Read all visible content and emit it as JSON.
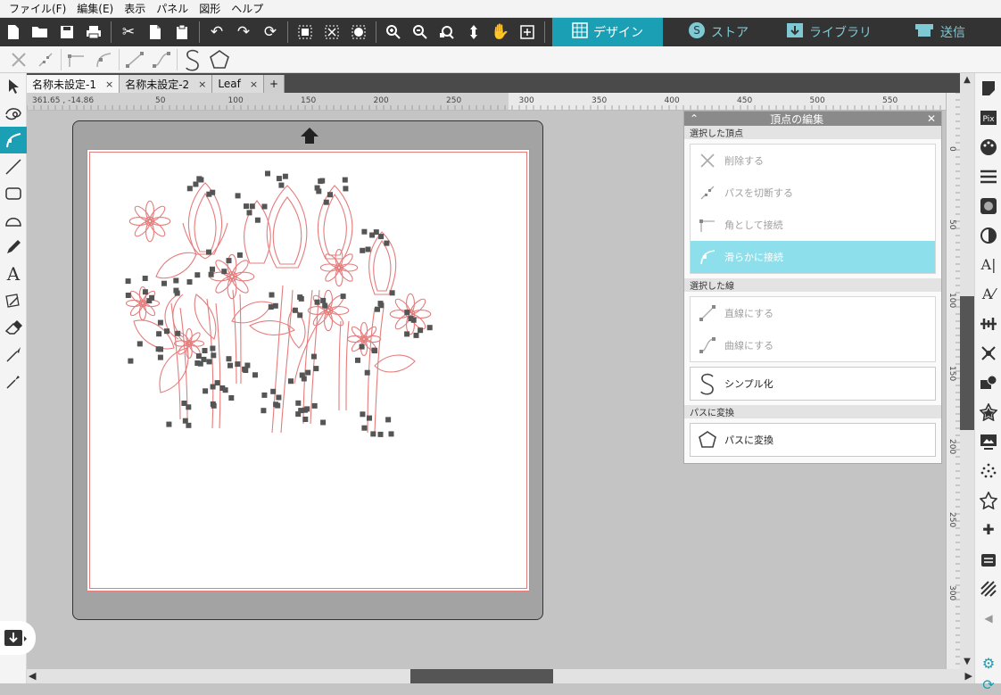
{
  "menu": [
    "ファイル(F)",
    "編集(E)",
    "表示",
    "パネル",
    "図形",
    "ヘルプ"
  ],
  "toolbar_icons": [
    "new-file-icon",
    "open-folder-icon",
    "save-icon",
    "print-icon",
    "cut-icon",
    "copy-icon",
    "paste-icon",
    "undo-icon",
    "redo-icon",
    "refresh-icon",
    "group-icon",
    "ungroup-icon",
    "palette-icon",
    "zoom-in-icon",
    "zoom-out-icon",
    "zoom-select-icon",
    "move-icon",
    "pan-hand-icon",
    "fit-page-icon"
  ],
  "mode_tabs": [
    {
      "label": "デザイン",
      "icon": "grid-icon",
      "active": true
    },
    {
      "label": "ストア",
      "icon": "store-icon",
      "active": false
    },
    {
      "label": "ライブラリ",
      "icon": "library-icon",
      "active": false
    },
    {
      "label": "送信",
      "icon": "send-icon",
      "active": false
    }
  ],
  "doc_tabs": [
    {
      "label": "名称未設定-1",
      "active": true
    },
    {
      "label": "名称未設定-2",
      "active": false
    },
    {
      "label": "Leaf",
      "active": false
    }
  ],
  "add_tab": "+",
  "coordinates": "361.65 , -14.86",
  "ruler_h": [
    "50",
    "100",
    "150",
    "200",
    "250",
    "300",
    "350",
    "400",
    "450",
    "500",
    "550"
  ],
  "ruler_v": [
    "0",
    "50",
    "100",
    "150",
    "200",
    "250",
    "300"
  ],
  "panel": {
    "title": "頂点の編集",
    "section1": "選択した頂点",
    "delete": "削除する",
    "cut_path": "パスを切断する",
    "corner": "角として接続",
    "smooth": "滑らかに接続",
    "section2": "選択した線",
    "straight": "直線にする",
    "curve": "曲線にする",
    "simplify": "シンプル化",
    "section3": "パスに変換",
    "to_path": "パスに変換"
  },
  "colors": {
    "accent": "#1a9fb4",
    "cut_line": "#e57c7c",
    "node": "#555555",
    "active_btn": "#8ddfeb"
  }
}
